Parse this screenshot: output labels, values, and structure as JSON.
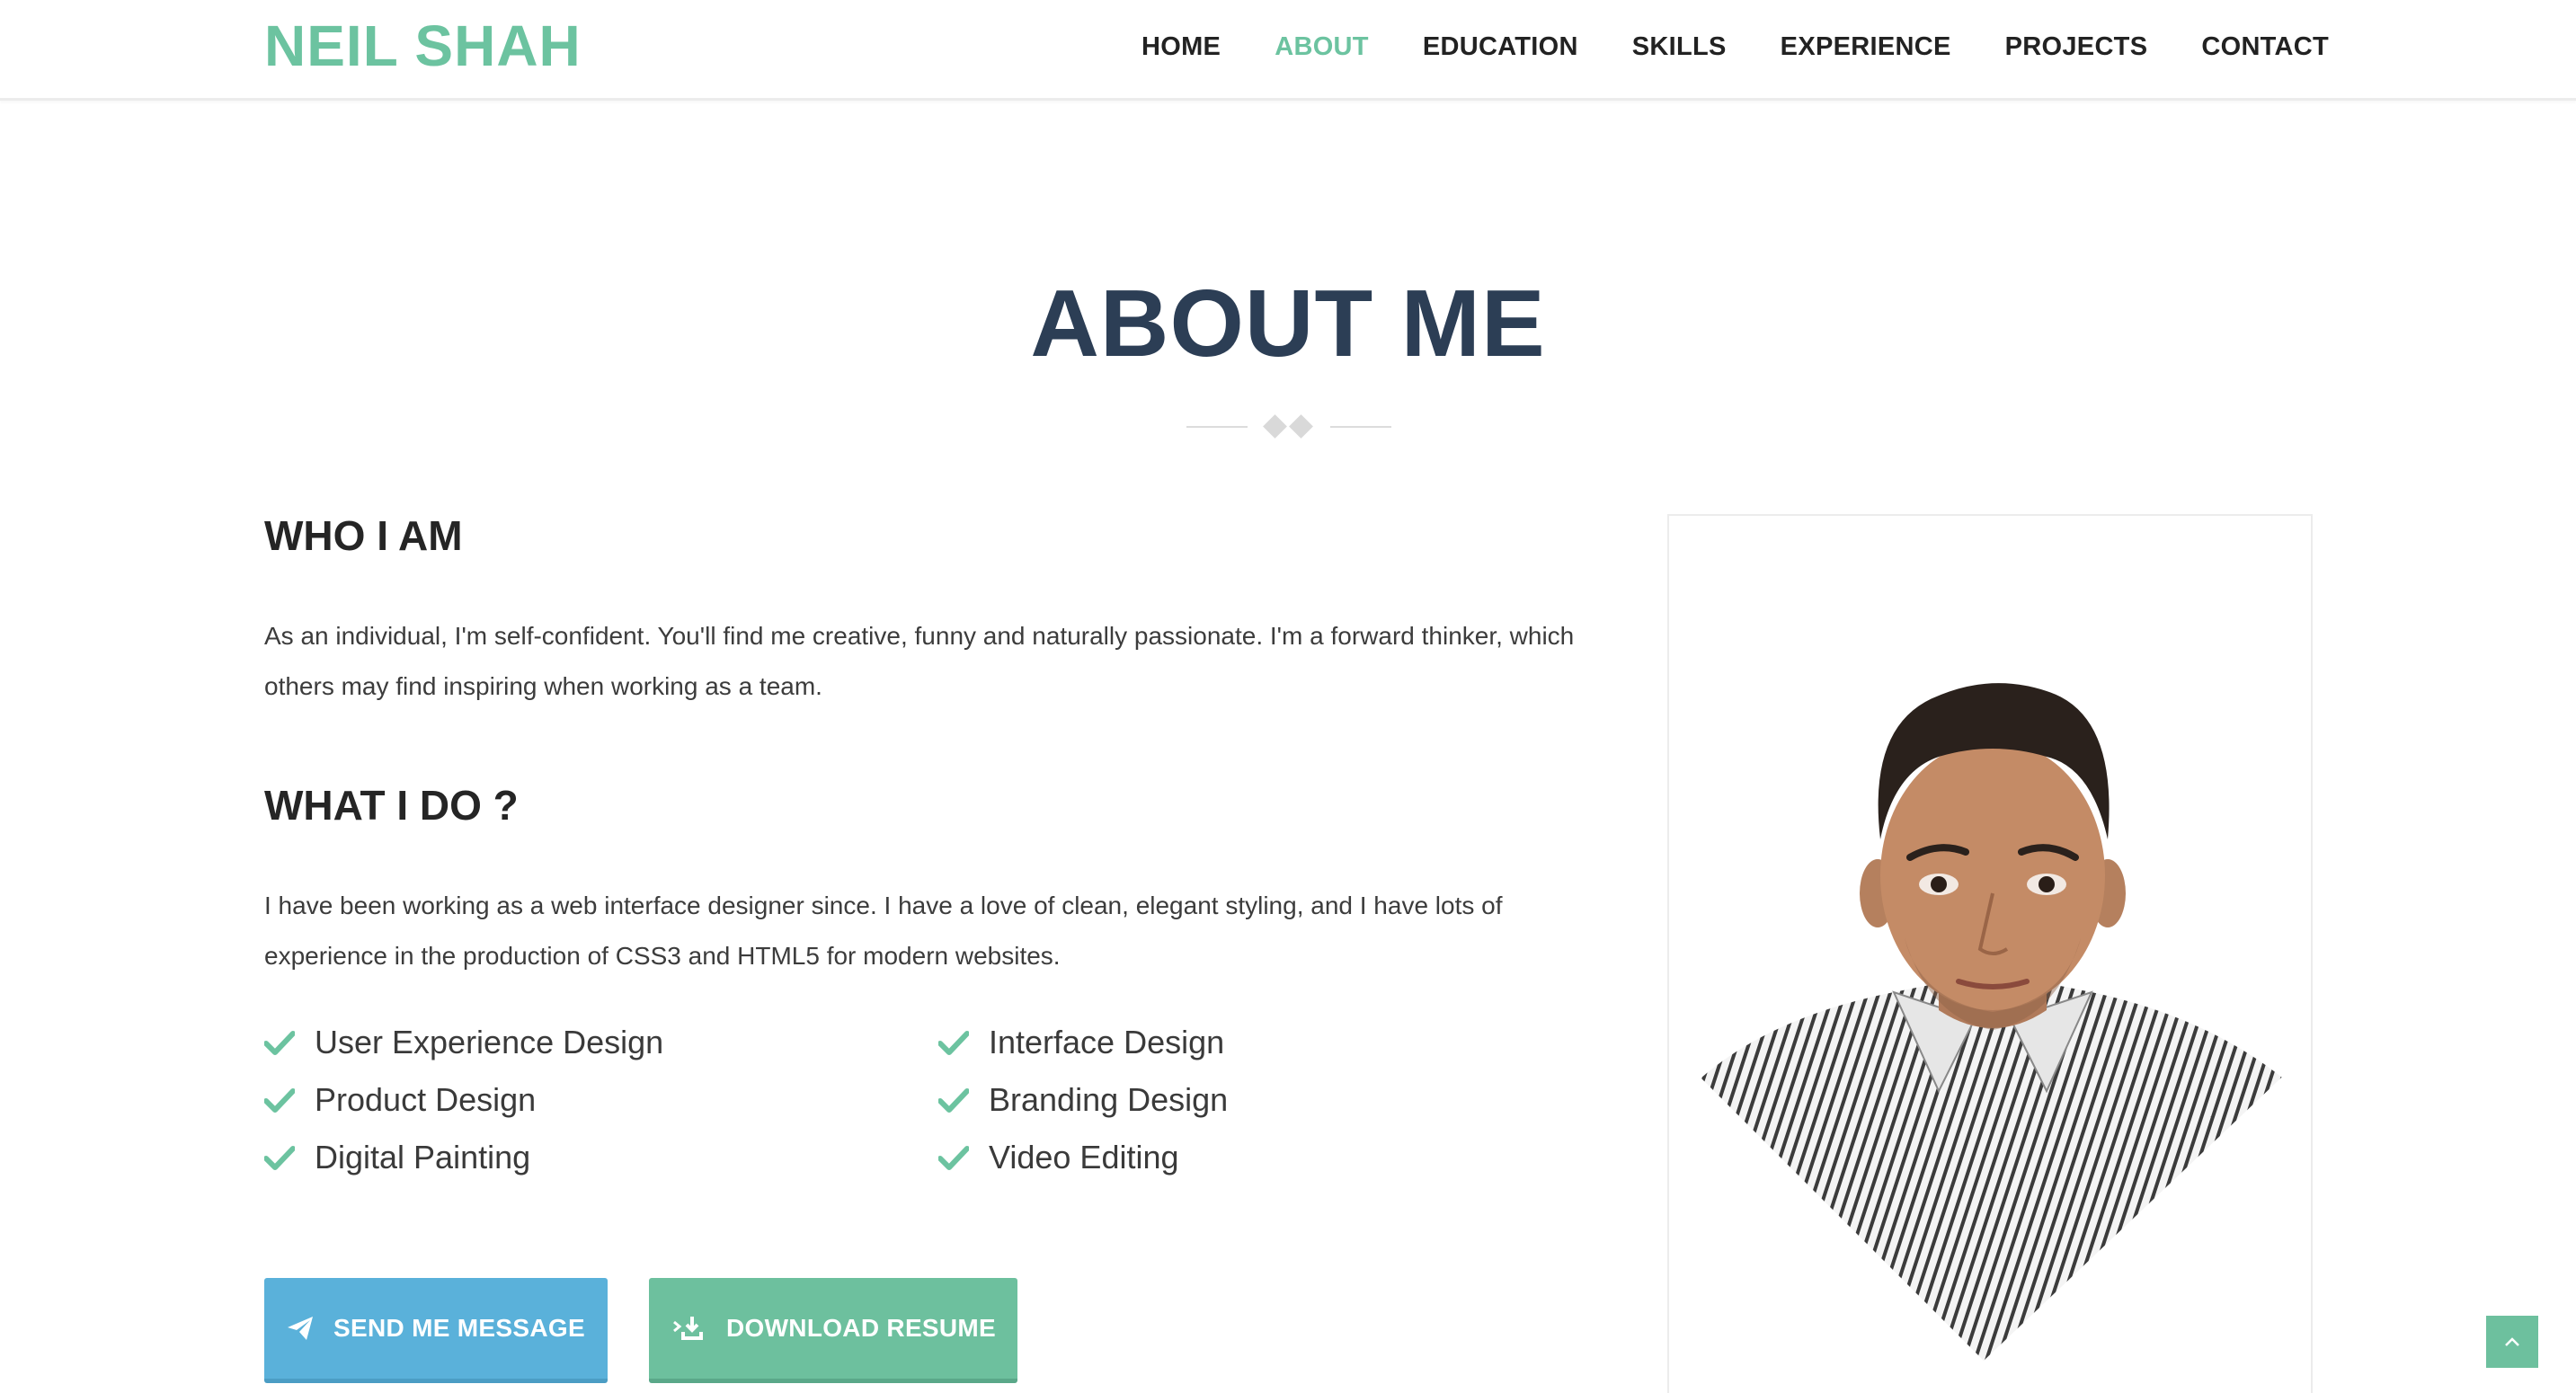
{
  "brand": {
    "name": "NEIL SHAH",
    "color": "#6cc3a0"
  },
  "nav": {
    "items": [
      {
        "label": "HOME",
        "active": false
      },
      {
        "label": "ABOUT",
        "active": true
      },
      {
        "label": "EDUCATION",
        "active": false
      },
      {
        "label": "SKILLS",
        "active": false
      },
      {
        "label": "EXPERIENCE",
        "active": false
      },
      {
        "label": "PROJECTS",
        "active": false
      },
      {
        "label": "CONTACT",
        "active": false
      }
    ]
  },
  "section": {
    "title": "ABOUT ME"
  },
  "who": {
    "heading": "WHO I AM",
    "text": "As an individual, I'm self-confident. You'll find me creative, funny and naturally passionate. I'm a forward thinker, which others may find inspiring when working as a team."
  },
  "what": {
    "heading": "WHAT I DO ?",
    "text": "I have been working as a web interface designer since. I have a love of clean, elegant styling, and I have lots of experience in the production of CSS3 and HTML5 for modern websites."
  },
  "skills": [
    "User Experience Design",
    "Interface Design",
    "Product Design",
    "Branding Design",
    "Digital Painting",
    "Video Editing"
  ],
  "buttons": {
    "message": {
      "label": "SEND ME MESSAGE",
      "icon": "paper-plane-icon",
      "color": "#5ab1da"
    },
    "resume": {
      "label": "DOWNLOAD RESUME",
      "icon": "download-icon",
      "color": "#6dc09e"
    }
  },
  "colors": {
    "accent": "#6cc3a0",
    "title": "#2c3e55"
  },
  "icons": {
    "skill": "check-icon",
    "back_to_top": "chevron-up-icon"
  }
}
